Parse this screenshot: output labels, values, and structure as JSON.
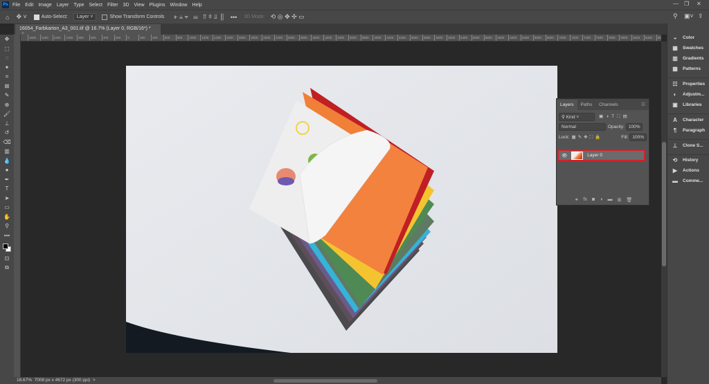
{
  "menubar": {
    "logo": "Ps",
    "items": [
      "File",
      "Edit",
      "Image",
      "Layer",
      "Type",
      "Select",
      "Filter",
      "3D",
      "View",
      "Plugins",
      "Window",
      "Help"
    ]
  },
  "options": {
    "auto_select_label": "Auto-Select:",
    "auto_select_checked": true,
    "target_value": "Layer",
    "show_transform_label": "Show Transform Controls",
    "show_transform_checked": false,
    "mode_3d_label": "3D Mode:"
  },
  "document_tab": {
    "title": "16054_Farbkarton_A3_001.tif @ 16.7% (Layer 0, RGB/16*) *",
    "close": "×"
  },
  "ruler": {
    "labels": [
      "1600",
      "1400",
      "1200",
      "1000",
      "800",
      "600",
      "400",
      "200",
      "0",
      "200",
      "400",
      "600",
      "800",
      "1000",
      "1200",
      "1400",
      "1600",
      "1800",
      "2000",
      "2200",
      "2400",
      "2600",
      "2800",
      "3000",
      "3200",
      "3400",
      "3600",
      "3800",
      "4000",
      "4200",
      "4400",
      "4600",
      "4800",
      "5000",
      "5200",
      "5400",
      "5600",
      "5800",
      "6000",
      "6200",
      "6400",
      "6600",
      "6800",
      "7000",
      "7200",
      "7400",
      "7600",
      "7800",
      "8000",
      "8200",
      "8400",
      "8600"
    ]
  },
  "status": {
    "zoom": "16.67%",
    "doc_info": "7008 px x 4672 px (300 ppi)",
    "arrow": ">"
  },
  "dock": {
    "items": [
      {
        "icon": "color-icon",
        "glyph": "◒",
        "label": "Color"
      },
      {
        "icon": "swatches-icon",
        "glyph": "▦",
        "label": "Swatches"
      },
      {
        "icon": "gradients-icon",
        "glyph": "▥",
        "label": "Gradients"
      },
      {
        "icon": "patterns-icon",
        "glyph": "▩",
        "label": "Patterns"
      },
      {
        "icon": "properties-icon",
        "glyph": "☷",
        "label": "Properties"
      },
      {
        "icon": "adjustments-icon",
        "glyph": "◐",
        "label": "Adjustm..."
      },
      {
        "icon": "libraries-icon",
        "glyph": "▣",
        "label": "Libraries"
      },
      {
        "icon": "character-icon",
        "glyph": "A",
        "label": "Character"
      },
      {
        "icon": "paragraph-icon",
        "glyph": "¶",
        "label": "Paragraph"
      },
      {
        "icon": "clone-source-icon",
        "glyph": "⊥",
        "label": "Clone S..."
      },
      {
        "icon": "history-icon",
        "glyph": "⟲",
        "label": "History"
      },
      {
        "icon": "actions-icon",
        "glyph": "▶",
        "label": "Actions"
      },
      {
        "icon": "comments-icon",
        "glyph": "▬",
        "label": "Comme..."
      }
    ]
  },
  "layers_panel": {
    "tabs": [
      "Layers",
      "Paths",
      "Channels"
    ],
    "active_tab": "Layers",
    "filter_value": "Kind",
    "blend_mode": "Normal",
    "opacity_label": "Opacity:",
    "opacity_value": "100%",
    "lock_label": "Lock:",
    "fill_label": "Fill:",
    "fill_value": "100%",
    "layers": [
      {
        "name": "Layer 0",
        "visible": true,
        "selected": true
      }
    ],
    "highlight_color": "#d1202b"
  },
  "toolbar": {
    "tools": [
      "move",
      "marquee",
      "lasso",
      "magic-wand",
      "crop",
      "frame",
      "eyedropper",
      "healing",
      "brush",
      "stamp",
      "history-brush",
      "eraser",
      "gradient",
      "blur",
      "dodge",
      "pen",
      "type",
      "path-select",
      "rectangle",
      "hand",
      "zoom",
      "more"
    ]
  },
  "colors": {
    "foreground": "#000000",
    "background": "#ffffff",
    "canvas_bg": "#282828"
  }
}
